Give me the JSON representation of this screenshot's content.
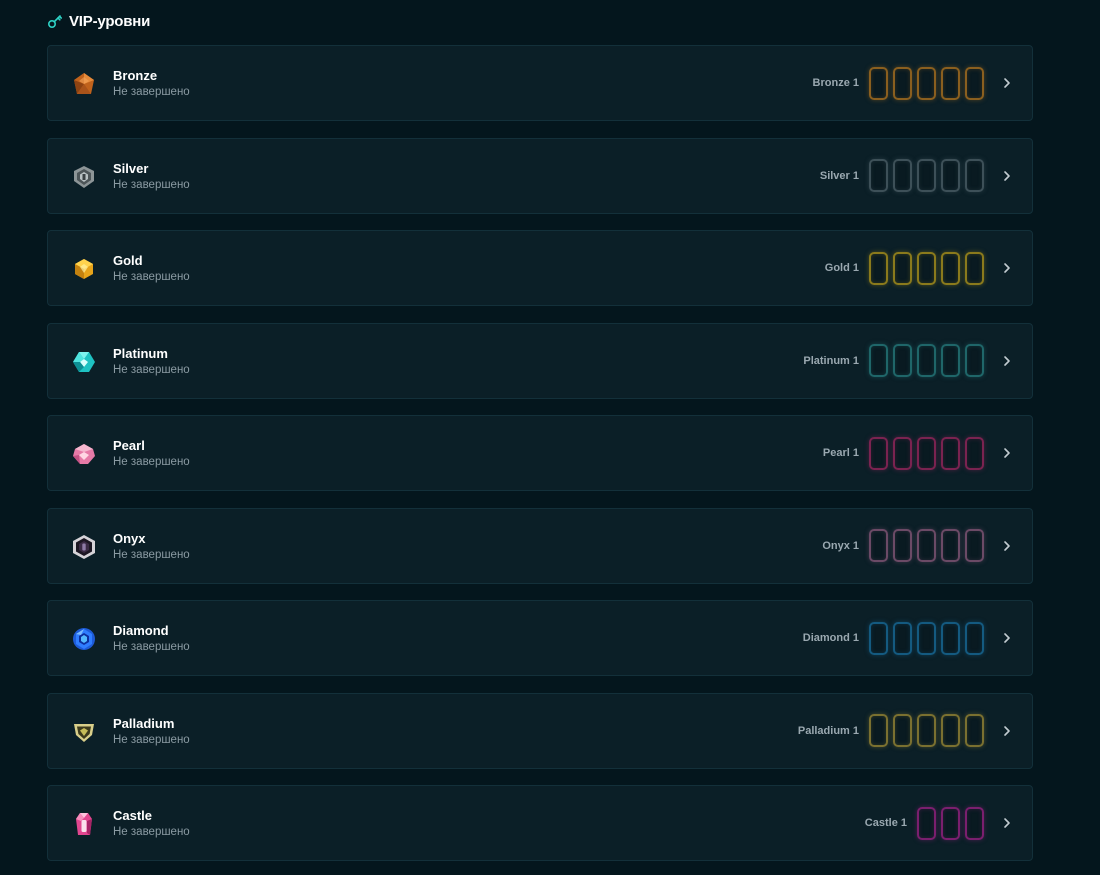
{
  "header": {
    "title": "VIP-уровни",
    "icon": "key-icon",
    "icon_color": "#2ed3c6"
  },
  "levels": [
    {
      "id": "bronze",
      "name": "Bronze",
      "status": "Не завершено",
      "sublevel": "Bronze 1",
      "color": "#8a5f1f",
      "boxes": 5,
      "icon": "bronze-gem-icon"
    },
    {
      "id": "silver",
      "name": "Silver",
      "status": "Не завершено",
      "sublevel": "Silver 1",
      "color": "#3d5058",
      "boxes": 5,
      "icon": "silver-shield-icon"
    },
    {
      "id": "gold",
      "name": "Gold",
      "status": "Не завершено",
      "sublevel": "Gold 1",
      "color": "#8a7a1c",
      "boxes": 5,
      "icon": "gold-gem-icon"
    },
    {
      "id": "platinum",
      "name": "Platinum",
      "status": "Не завершено",
      "sublevel": "Platinum 1",
      "color": "#1f6669",
      "boxes": 5,
      "icon": "platinum-gem-icon"
    },
    {
      "id": "pearl",
      "name": "Pearl",
      "status": "Не завершено",
      "sublevel": "Pearl 1",
      "color": "#7a2350",
      "boxes": 5,
      "icon": "pearl-gem-icon"
    },
    {
      "id": "onyx",
      "name": "Onyx",
      "status": "Не завершено",
      "sublevel": "Onyx 1",
      "color": "#6b4a66",
      "boxes": 5,
      "icon": "onyx-shield-icon"
    },
    {
      "id": "diamond",
      "name": "Diamond",
      "status": "Не завершено",
      "sublevel": "Diamond 1",
      "color": "#145a80",
      "boxes": 5,
      "icon": "diamond-gem-icon"
    },
    {
      "id": "palladium",
      "name": "Palladium",
      "status": "Не завершено",
      "sublevel": "Palladium 1",
      "color": "#7a7030",
      "boxes": 5,
      "icon": "palladium-shield-icon"
    },
    {
      "id": "castle",
      "name": "Castle",
      "status": "Не завершено",
      "sublevel": "Castle 1",
      "color": "#7a1f6e",
      "boxes": 3,
      "icon": "castle-crystal-icon"
    }
  ]
}
